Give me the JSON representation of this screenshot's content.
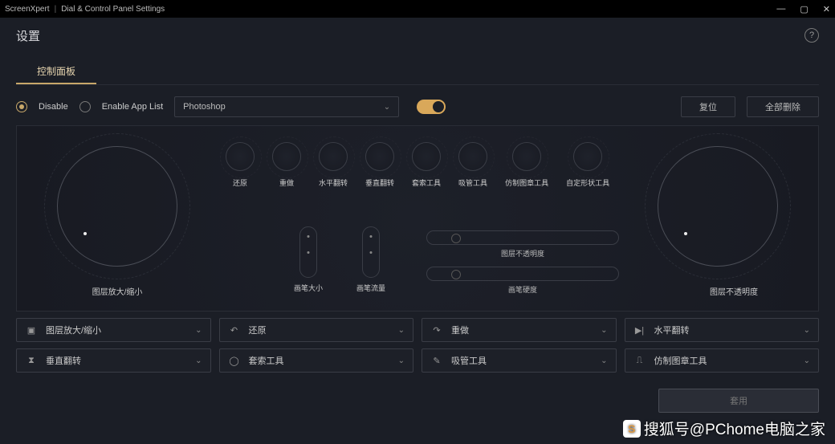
{
  "titlebar": {
    "app": "ScreenXpert",
    "window": "Dial & Control Panel Settings"
  },
  "header": {
    "title": "设置"
  },
  "tabs": {
    "active": "控制面板"
  },
  "options": {
    "disable": {
      "label": "Disable",
      "checked": true
    },
    "enableAppList": {
      "label": "Enable App List",
      "checked": false
    },
    "appDropdown": "Photoshop",
    "resetBtn": "复位",
    "deleteAllBtn": "全部删除"
  },
  "leftDial": {
    "label": "图层放大/缩小"
  },
  "rightDial": {
    "label": "图层不透明度"
  },
  "smallButtons": [
    {
      "label": "还原"
    },
    {
      "label": "重做"
    },
    {
      "label": "水平翻转"
    },
    {
      "label": "垂直翻转"
    },
    {
      "label": "套索工具"
    },
    {
      "label": "吸管工具"
    },
    {
      "label": "仿制图章工具"
    },
    {
      "label": "自定形状工具"
    }
  ],
  "pills": [
    {
      "label": "画笔大小"
    },
    {
      "label": "画笔流量"
    }
  ],
  "sliders": [
    {
      "label": "图层不透明度"
    },
    {
      "label": "画笔硬度"
    }
  ],
  "selectorGrid": [
    {
      "icon": "layers-icon",
      "glyph": "▣",
      "label": "图层放大/缩小"
    },
    {
      "icon": "undo-icon",
      "glyph": "↶",
      "label": "还原"
    },
    {
      "icon": "redo-icon",
      "glyph": "↷",
      "label": "重做"
    },
    {
      "icon": "flip-h-icon",
      "glyph": "▶|",
      "label": "水平翻转"
    },
    {
      "icon": "flip-v-icon",
      "glyph": "⧗",
      "label": "垂直翻转"
    },
    {
      "icon": "lasso-icon",
      "glyph": "◯",
      "label": "套索工具"
    },
    {
      "icon": "eyedropper-icon",
      "glyph": "✎",
      "label": "吸管工具"
    },
    {
      "icon": "clone-stamp-icon",
      "glyph": "⎍",
      "label": "仿制图章工具"
    }
  ],
  "footer": {
    "apply": "套用"
  },
  "watermark": "搜狐号@PChome电脑之家"
}
